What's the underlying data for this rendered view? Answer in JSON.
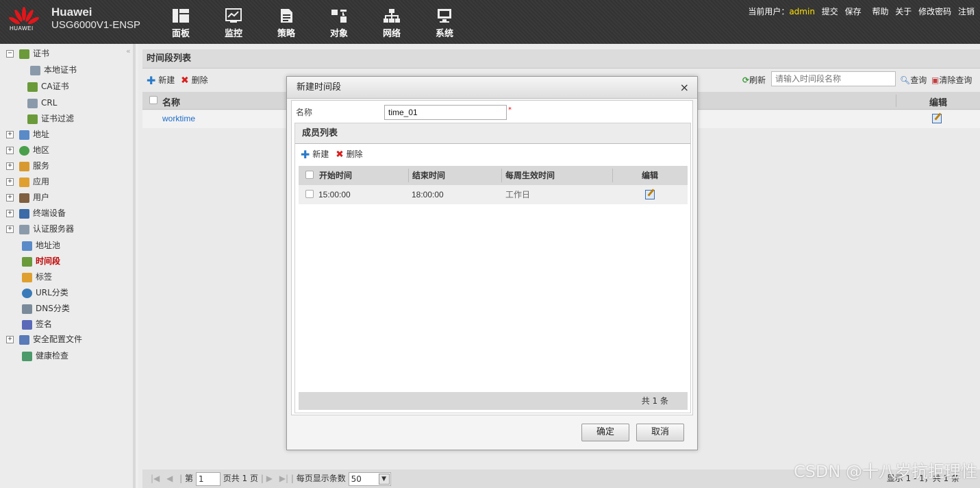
{
  "header": {
    "brand": "Huawei",
    "model": "USG6000V1-ENSP",
    "logo_text": "HUAWEI",
    "nav": [
      {
        "label": "面板",
        "icon": "dashboard-icon"
      },
      {
        "label": "监控",
        "icon": "monitor-icon"
      },
      {
        "label": "策略",
        "icon": "policy-icon"
      },
      {
        "label": "对象",
        "icon": "object-icon"
      },
      {
        "label": "网络",
        "icon": "network-icon"
      },
      {
        "label": "系统",
        "icon": "system-icon"
      }
    ],
    "user_label": "当前用户：",
    "user_name": "admin",
    "links": [
      "提交",
      "保存",
      "帮助",
      "关于",
      "修改密码",
      "注销"
    ]
  },
  "sidebar": {
    "items": [
      {
        "label": "证书",
        "expander": "−"
      },
      {
        "label": "本地证书"
      },
      {
        "label": "CA证书"
      },
      {
        "label": "CRL"
      },
      {
        "label": "证书过滤"
      },
      {
        "label": "地址",
        "expander": "+"
      },
      {
        "label": "地区",
        "expander": "+"
      },
      {
        "label": "服务",
        "expander": "+"
      },
      {
        "label": "应用",
        "expander": "+"
      },
      {
        "label": "用户",
        "expander": "+"
      },
      {
        "label": "终端设备",
        "expander": "+"
      },
      {
        "label": "认证服务器",
        "expander": "+"
      },
      {
        "label": "地址池"
      },
      {
        "label": "时间段",
        "active": true
      },
      {
        "label": "标签"
      },
      {
        "label": "URL分类"
      },
      {
        "label": "DNS分类"
      },
      {
        "label": "签名"
      },
      {
        "label": "安全配置文件",
        "expander": "+"
      },
      {
        "label": "健康检查"
      }
    ]
  },
  "main": {
    "title": "时间段列表",
    "toolbar": {
      "new": "新建",
      "delete": "删除",
      "refresh": "刷新",
      "search_placeholder": "请输入时间段名称",
      "query": "查询",
      "clear": "清除查询"
    },
    "columns": {
      "name": "名称",
      "edit": "编辑"
    },
    "rows": [
      {
        "name": "worktime"
      }
    ],
    "pager": {
      "page_prefix": "第",
      "page": "1",
      "page_suffix": "页共 1 页",
      "per_page_label": "每页显示条数",
      "per_page": "50",
      "summary": "显示 1 - 1，共 1 条"
    }
  },
  "modal": {
    "title": "新建时间段",
    "close": "×",
    "name_label": "名称",
    "name_value": "time_01",
    "required": "*",
    "members_title": "成员列表",
    "new": "新建",
    "delete": "删除",
    "columns": {
      "start": "开始时间",
      "end": "结束时间",
      "weekly": "每周生效时间",
      "edit": "编辑"
    },
    "rows": [
      {
        "start": "15:00:00",
        "end": "18:00:00",
        "weekly": "工作日"
      }
    ],
    "footer": "共 1 条",
    "ok": "确定",
    "cancel": "取消"
  },
  "watermark": "CSDN @十八岁抗拒理性"
}
